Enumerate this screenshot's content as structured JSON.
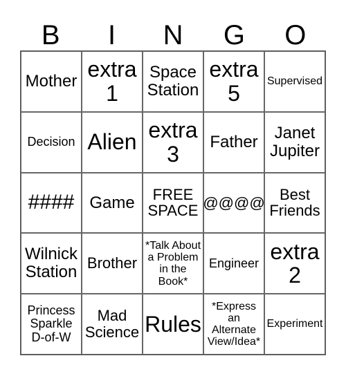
{
  "header": [
    "B",
    "I",
    "N",
    "G",
    "O"
  ],
  "cells": [
    {
      "text": "Mother",
      "size": "s24"
    },
    {
      "text": "extra 1",
      "size": "s32"
    },
    {
      "text": "Space Station",
      "size": "s24"
    },
    {
      "text": "extra 5",
      "size": "s32"
    },
    {
      "text": "Supervised",
      "size": "s16"
    },
    {
      "text": "Decision",
      "size": "s18"
    },
    {
      "text": "Alien",
      "size": "s32"
    },
    {
      "text": "extra 3",
      "size": "s32"
    },
    {
      "text": "Father",
      "size": "s24"
    },
    {
      "text": "Janet Jupiter",
      "size": "s24"
    },
    {
      "text": "####",
      "size": "s30"
    },
    {
      "text": "Game",
      "size": "s24"
    },
    {
      "text": "FREE SPACE",
      "size": "s22"
    },
    {
      "text": "@@@@",
      "size": "s22"
    },
    {
      "text": "Best Friends",
      "size": "s22"
    },
    {
      "text": "Wilnick Station",
      "size": "s24"
    },
    {
      "text": "Brother",
      "size": "s22"
    },
    {
      "text": "*Talk About a Problem in the Book*",
      "size": "s16"
    },
    {
      "text": "Engineer",
      "size": "s18"
    },
    {
      "text": "extra 2",
      "size": "s32"
    },
    {
      "text": "Princess Sparkle D-of-W",
      "size": "s18"
    },
    {
      "text": "Mad Science",
      "size": "s22"
    },
    {
      "text": "Rules",
      "size": "s32"
    },
    {
      "text": "*Express an Alternate View/Idea*",
      "size": "s16"
    },
    {
      "text": "Experiment",
      "size": "s16"
    }
  ]
}
